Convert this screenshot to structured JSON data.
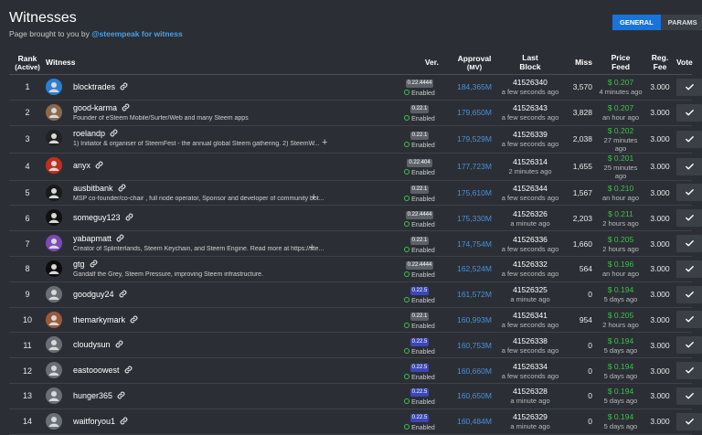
{
  "header": {
    "title": "Witnesses",
    "subtitle_prefix": "Page brought to you by ",
    "subtitle_link": "@steempeak for witness"
  },
  "tabs": [
    {
      "label": "GENERAL",
      "active": true
    },
    {
      "label": "PARAMS",
      "active": false
    }
  ],
  "columns": {
    "rank_line1": "Rank",
    "rank_line2": "(Active)",
    "witness": "Witness",
    "ver": "Ver.",
    "approval_line1": "Approval",
    "approval_line2": "(MV)",
    "last_block_line1": "Last",
    "last_block_line2": "Block",
    "miss": "Miss",
    "price_line1": "Price",
    "price_line2": "Feed",
    "fee_line1": "Reg.",
    "fee_line2": "Fee",
    "vote": "Vote"
  },
  "rows": [
    {
      "rank": "1",
      "name": "blocktrades",
      "desc": "",
      "avatar_color": "#2a7fd4",
      "ver": "0.22.4444",
      "ver_new": false,
      "status": "Enabled",
      "approval": "184,365M",
      "block": "41526340",
      "block_time": "a few seconds ago",
      "miss": "3,570",
      "price": "$ 0.207",
      "price_time": "4 minutes ago",
      "fee": "3.000",
      "plus": false
    },
    {
      "rank": "2",
      "name": "good-karma",
      "desc": "Founder of eSteem Mobile/Surfer/Web and many Steem apps",
      "avatar_color": "#8a6a4e",
      "ver": "0.22.1",
      "ver_new": false,
      "status": "Enabled",
      "approval": "179,650M",
      "block": "41526343",
      "block_time": "a few seconds ago",
      "miss": "3,828",
      "price": "$ 0.207",
      "price_time": "an hour ago",
      "fee": "3.000",
      "plus": false
    },
    {
      "rank": "3",
      "name": "roelandp",
      "desc": "1) Initiator & organiser of SteemFest - the annual global Steem gathering. 2) SteemW...",
      "avatar_color": "#222222",
      "ver": "0.22.1",
      "ver_new": false,
      "status": "Enabled",
      "approval": "179,529M",
      "block": "41526339",
      "block_time": "a few seconds ago",
      "miss": "2,038",
      "price": "$ 0.202",
      "price_time": "27 minutes ago",
      "fee": "3.000",
      "plus": true
    },
    {
      "rank": "4",
      "name": "anyx",
      "desc": "",
      "avatar_color": "#c0301e",
      "ver": "0.22.404",
      "ver_new": false,
      "status": "Enabled",
      "approval": "177,723M",
      "block": "41526314",
      "block_time": "2 minutes ago",
      "miss": "1,655",
      "price": "$ 0.201",
      "price_time": "25 minutes ago",
      "fee": "3.000",
      "plus": false
    },
    {
      "rank": "5",
      "name": "ausbitbank",
      "desc": "MSP co-founder/co-chair , full node operator, Sponsor and developer of community bot...",
      "avatar_color": "#1a1a1a",
      "ver": "0.22.1",
      "ver_new": false,
      "status": "Enabled",
      "approval": "175,610M",
      "block": "41526344",
      "block_time": "a few seconds ago",
      "miss": "1,567",
      "price": "$ 0.210",
      "price_time": "an hour ago",
      "fee": "3.000",
      "plus": true
    },
    {
      "rank": "6",
      "name": "someguy123",
      "desc": "",
      "avatar_color": "#111111",
      "ver": "0.22.4444",
      "ver_new": false,
      "status": "Enabled",
      "approval": "175,330M",
      "block": "41526326",
      "block_time": "a minute ago",
      "miss": "2,203",
      "price": "$ 0.211",
      "price_time": "2 hours ago",
      "fee": "3.000",
      "plus": false
    },
    {
      "rank": "7",
      "name": "yabapmatt",
      "desc": "Creator of Splinterlands, Steem Keychain, and Steem Engine. Read more at https://ste...",
      "avatar_color": "#7b4bb8",
      "ver": "0.22.1",
      "ver_new": false,
      "status": "Enabled",
      "approval": "174,754M",
      "block": "41526336",
      "block_time": "a few seconds ago",
      "miss": "1,660",
      "price": "$ 0.205",
      "price_time": "2 hours ago",
      "fee": "3.000",
      "plus": true
    },
    {
      "rank": "8",
      "name": "gtg",
      "desc": "Gandalf the Grey, Steem Pressure, improving Steem infrastructure.",
      "avatar_color": "#0d0d0d",
      "ver": "0.22.4444",
      "ver_new": false,
      "status": "Enabled",
      "approval": "162,524M",
      "block": "41526332",
      "block_time": "a few seconds ago",
      "miss": "564",
      "price": "$ 0.196",
      "price_time": "an hour ago",
      "fee": "3.000",
      "plus": false
    },
    {
      "rank": "9",
      "name": "goodguy24",
      "desc": "",
      "avatar_color": "#6a6e75",
      "ver": "0.22.5",
      "ver_new": true,
      "status": "Enabled",
      "approval": "161,572M",
      "block": "41526325",
      "block_time": "a minute ago",
      "miss": "0",
      "price": "$ 0.194",
      "price_time": "5 days ago",
      "fee": "3.000",
      "plus": false
    },
    {
      "rank": "10",
      "name": "themarkymark",
      "desc": "",
      "avatar_color": "#9b5a3c",
      "ver": "0.22.1",
      "ver_new": false,
      "status": "Enabled",
      "approval": "160,993M",
      "block": "41526341",
      "block_time": "a few seconds ago",
      "miss": "954",
      "price": "$ 0.205",
      "price_time": "2 hours ago",
      "fee": "3.000",
      "plus": false
    },
    {
      "rank": "11",
      "name": "cloudysun",
      "desc": "",
      "avatar_color": "#6a6e75",
      "ver": "0.22.5",
      "ver_new": true,
      "status": "Enabled",
      "approval": "160,753M",
      "block": "41526338",
      "block_time": "a few seconds ago",
      "miss": "0",
      "price": "$ 0.194",
      "price_time": "5 days ago",
      "fee": "3.000",
      "plus": false
    },
    {
      "rank": "12",
      "name": "eastooowest",
      "desc": "",
      "avatar_color": "#6a6e75",
      "ver": "0.22.5",
      "ver_new": true,
      "status": "Enabled",
      "approval": "160,660M",
      "block": "41526334",
      "block_time": "a few seconds ago",
      "miss": "0",
      "price": "$ 0.194",
      "price_time": "5 days ago",
      "fee": "3.000",
      "plus": false
    },
    {
      "rank": "13",
      "name": "hunger365",
      "desc": "",
      "avatar_color": "#6a6e75",
      "ver": "0.22.5",
      "ver_new": true,
      "status": "Enabled",
      "approval": "160,650M",
      "block": "41526328",
      "block_time": "a minute ago",
      "miss": "0",
      "price": "$ 0.194",
      "price_time": "5 days ago",
      "fee": "3.000",
      "plus": false
    },
    {
      "rank": "14",
      "name": "waitforyou1",
      "desc": "",
      "avatar_color": "#6a6e75",
      "ver": "0.22.5",
      "ver_new": true,
      "status": "Enabled",
      "approval": "160,484M",
      "block": "41526329",
      "block_time": "a minute ago",
      "miss": "0",
      "price": "$ 0.194",
      "price_time": "5 days ago",
      "fee": "3.000",
      "plus": false
    }
  ]
}
